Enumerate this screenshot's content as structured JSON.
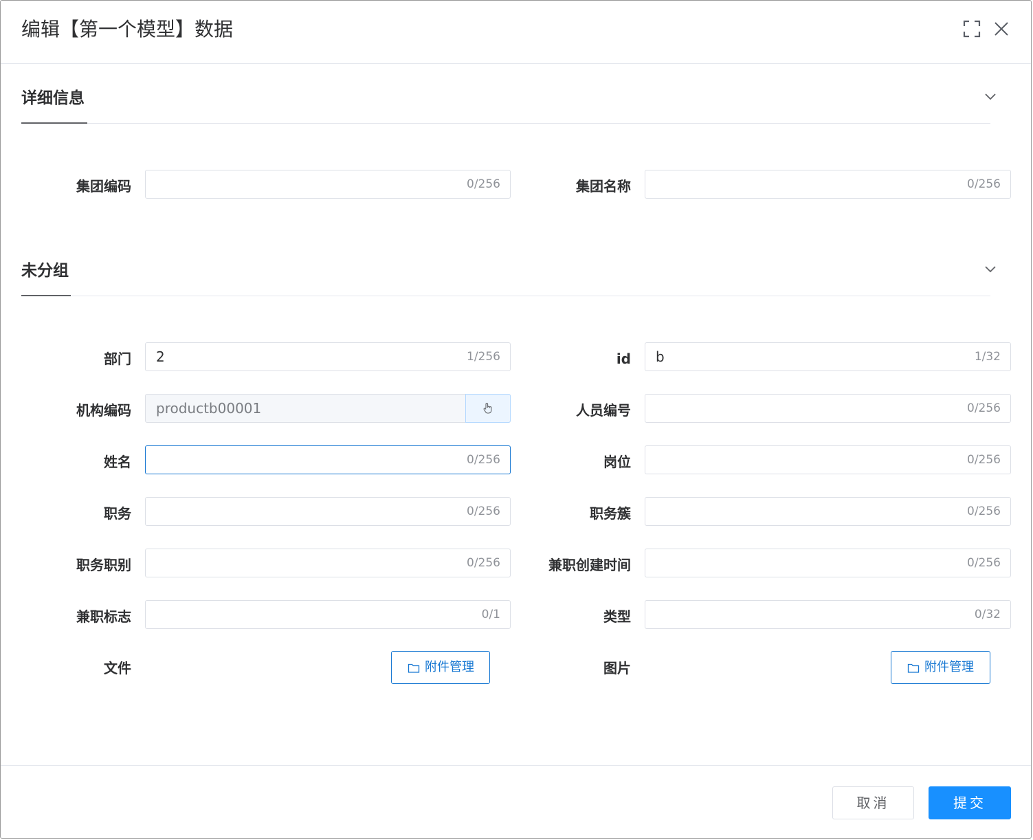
{
  "dialog": {
    "title": "编辑【第一个模型】数据",
    "fullscreen_icon": "fullscreen-icon",
    "close_icon": "close-icon"
  },
  "sections": [
    {
      "title": "详细信息",
      "fields": [
        {
          "label": "集团编码",
          "value": "",
          "count": "0/256"
        },
        {
          "label": "集团名称",
          "value": "",
          "count": "0/256"
        }
      ]
    },
    {
      "title": "未分组",
      "fields": [
        {
          "label": "部门",
          "value": "2",
          "count": "1/256"
        },
        {
          "label": "id",
          "value": "b",
          "count": "1/32"
        },
        {
          "label": "机构编码",
          "value": "productb00001",
          "count": ""
        },
        {
          "label": "人员编号",
          "value": "",
          "count": "0/256"
        },
        {
          "label": "姓名",
          "value": "",
          "count": "0/256"
        },
        {
          "label": "岗位",
          "value": "",
          "count": "0/256"
        },
        {
          "label": "职务",
          "value": "",
          "count": "0/256"
        },
        {
          "label": "职务簇",
          "value": "",
          "count": "0/256"
        },
        {
          "label": "职务职别",
          "value": "",
          "count": "0/256"
        },
        {
          "label": "兼职创建时间",
          "value": "",
          "count": "0/256"
        },
        {
          "label": "兼职标志",
          "value": "",
          "count": "0/1"
        },
        {
          "label": "类型",
          "value": "",
          "count": "0/32"
        },
        {
          "label": "文件",
          "button": "附件管理"
        },
        {
          "label": "图片",
          "button": "附件管理"
        }
      ]
    }
  ],
  "footer": {
    "cancel_label": "取消",
    "submit_label": "提交"
  },
  "colors": {
    "accent": "#1677d2",
    "primary_button": "#1890ff"
  }
}
